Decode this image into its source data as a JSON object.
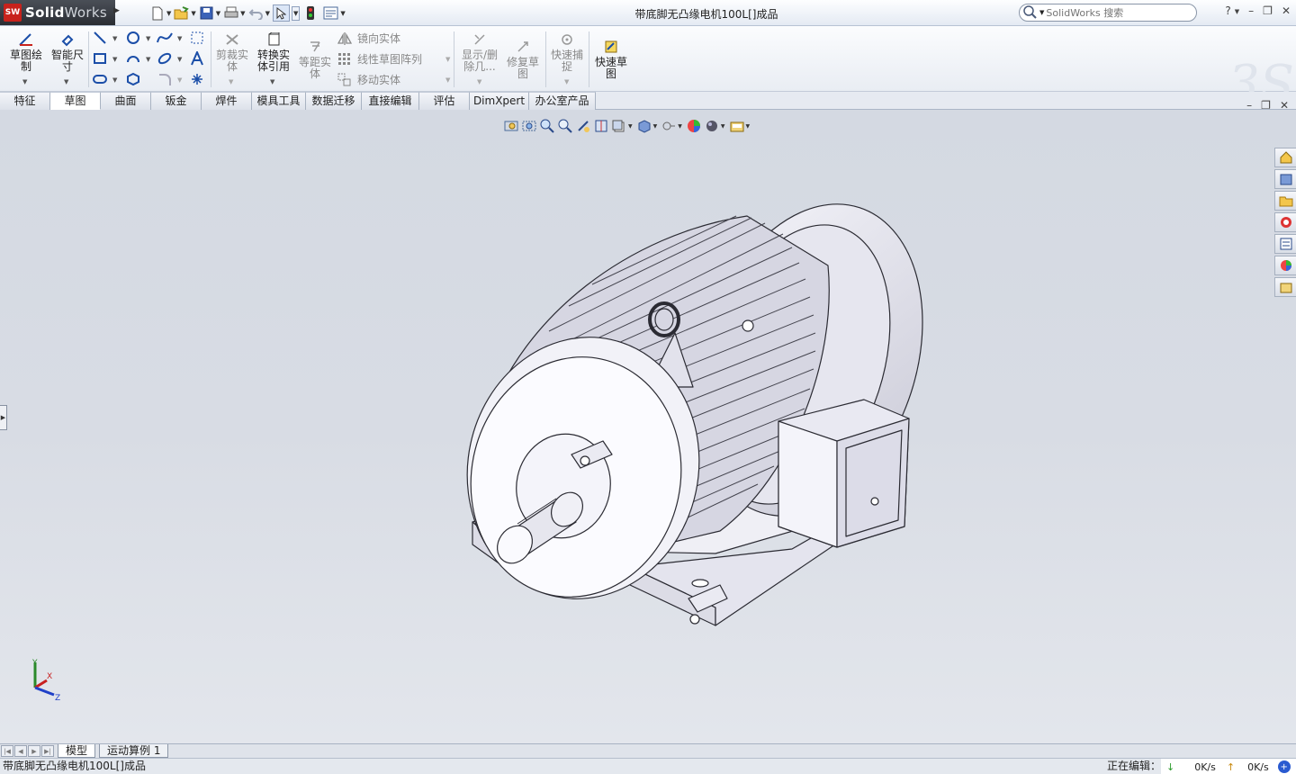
{
  "app": {
    "brand_prefix": "Solid",
    "brand_suffix": "Works",
    "logo_text": "SW"
  },
  "window": {
    "document_title": "带底脚无凸缘电机100L[]成品"
  },
  "search": {
    "placeholder": "SolidWorks 搜索",
    "icon": "search-icon"
  },
  "window_controls": [
    "?",
    "–",
    "❐",
    "✕"
  ],
  "quick_access": [
    "new-document-icon",
    "open-icon",
    "save-icon",
    "print-icon",
    "undo-icon",
    "select-icon",
    "rebuild-icon",
    "options-icon"
  ],
  "command_manager": {
    "sketch": "草图绘\n制",
    "smart_dim": "智能尺\n寸",
    "trim": "剪裁实\n体",
    "convert": "转换实\n体引用",
    "offset": "等距实\n体",
    "mirror": "镜向实体",
    "linear_pattern": "线性草图阵列",
    "move": "移动实体",
    "show_delete": "显示/删\n除几...",
    "repair": "修复草\n图",
    "quick_snap": "快速捕\n捉",
    "rapid_sketch": "快速草\n图"
  },
  "tabs": [
    {
      "label": "特征",
      "active": false
    },
    {
      "label": "草图",
      "active": true
    },
    {
      "label": "曲面",
      "active": false
    },
    {
      "label": "钣金",
      "active": false
    },
    {
      "label": "焊件",
      "active": false
    },
    {
      "label": "模具工具",
      "active": false
    },
    {
      "label": "数据迁移",
      "active": false
    },
    {
      "label": "直接编辑",
      "active": false
    },
    {
      "label": "评估",
      "active": false
    },
    {
      "label": "DimXpert",
      "active": false
    },
    {
      "label": "办公室产品",
      "active": false
    }
  ],
  "bottom_tabs": [
    {
      "label": "模型",
      "active": true
    },
    {
      "label": "运动算例 1",
      "active": false
    }
  ],
  "status": {
    "document": "带底脚无凸缘电机100L[]成品",
    "editing_label": "正在编辑：",
    "down_rate": "0K/s",
    "up_rate": "0K/s"
  },
  "triad": {
    "x": "X",
    "y": "Y",
    "z": "Z"
  },
  "colors": {
    "viewport_top": "#d4d9e2",
    "model_fill": "#e9e9f2",
    "model_edge": "#2b2b33",
    "accent_red": "#c8221c"
  }
}
